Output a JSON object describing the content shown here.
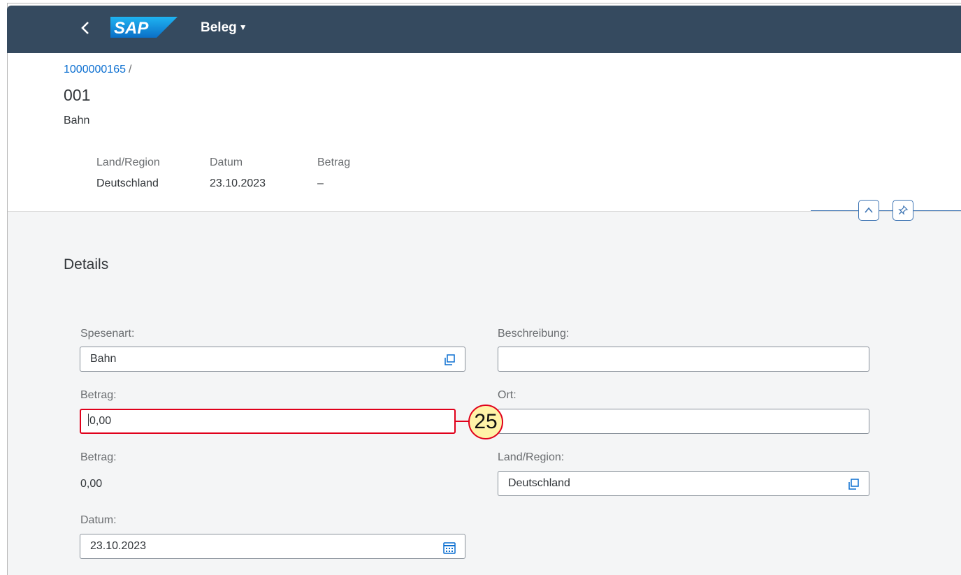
{
  "shellbar": {
    "logo_text": "SAP",
    "app_title": "Beleg"
  },
  "header": {
    "breadcrumb_link": "1000000165",
    "breadcrumb_sep": "/",
    "title": "001",
    "subtitle": "Bahn",
    "attributes": [
      {
        "label": "Land/Region",
        "value": "Deutschland"
      },
      {
        "label": "Datum",
        "value": "23.10.2023"
      },
      {
        "label": "Betrag",
        "value": "–"
      }
    ]
  },
  "details": {
    "section_title": "Details",
    "spesenart_label": "Spesenart:",
    "spesenart_value": "Bahn",
    "beschreibung_label": "Beschreibung:",
    "beschreibung_value": "",
    "betrag_input_label": "Betrag:",
    "betrag_input_value": "0,00",
    "ort_label": "Ort:",
    "ort_value": "",
    "betrag_display_label": "Betrag:",
    "betrag_display_value": "0,00",
    "land_label": "Land/Region:",
    "land_value": "Deutschland",
    "datum_label": "Datum:",
    "datum_value": "23.10.2023"
  },
  "annotation": {
    "callout_number": "25"
  },
  "icons": {
    "back": "chevron-left-icon",
    "title_menu": "triangle-down-icon",
    "collapse_header": "chevron-up-icon",
    "pin_header": "pin-icon",
    "value_help": "value-help-icon",
    "calendar": "calendar-icon"
  },
  "colors": {
    "shellbar": "#354a5f",
    "link": "#0a6ed1",
    "focus_highlight": "#e0001b",
    "callout_fill": "#fff3a8",
    "content_bg": "#f4f5f6"
  }
}
